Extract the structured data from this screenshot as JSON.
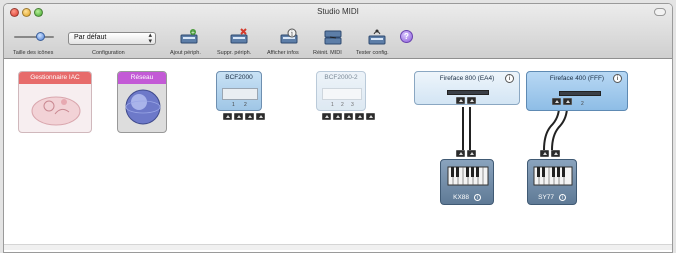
{
  "window": {
    "title": "Studio MIDI"
  },
  "toolbar": {
    "icon_size_label": "Taille des icônes",
    "configuration": {
      "value": "Par défaut",
      "label": "Configuration"
    },
    "add_device_label": "Ajout périph.",
    "remove_device_label": "Suppr. périph.",
    "show_info_label": "Afficher infos",
    "reset_midi_label": "Réinit. MIDI",
    "test_config_label": "Tester config."
  },
  "devices": {
    "iac": {
      "name": "Gestionnaire IAC"
    },
    "network": {
      "name": "Réseau"
    },
    "bcf2000": {
      "name": "BCF2000",
      "ports": [
        "1",
        "2"
      ]
    },
    "bcf2000_2": {
      "name": "BCF2000-2",
      "ports": [
        "1",
        "2",
        "3"
      ]
    },
    "ff800": {
      "name": "Fireface 800 (EA4)"
    },
    "ff400": {
      "name": "Fireface 400 (FFF)",
      "ports": [
        "1",
        "2"
      ]
    },
    "kx88": {
      "name": "KX88"
    },
    "sy77": {
      "name": "SY77"
    }
  },
  "colors": {
    "iac_header": "#e76b6b",
    "network_header": "#c35ad6",
    "interface_blue": "#9cc8ee",
    "keyboard_body": "#6f89a6"
  }
}
